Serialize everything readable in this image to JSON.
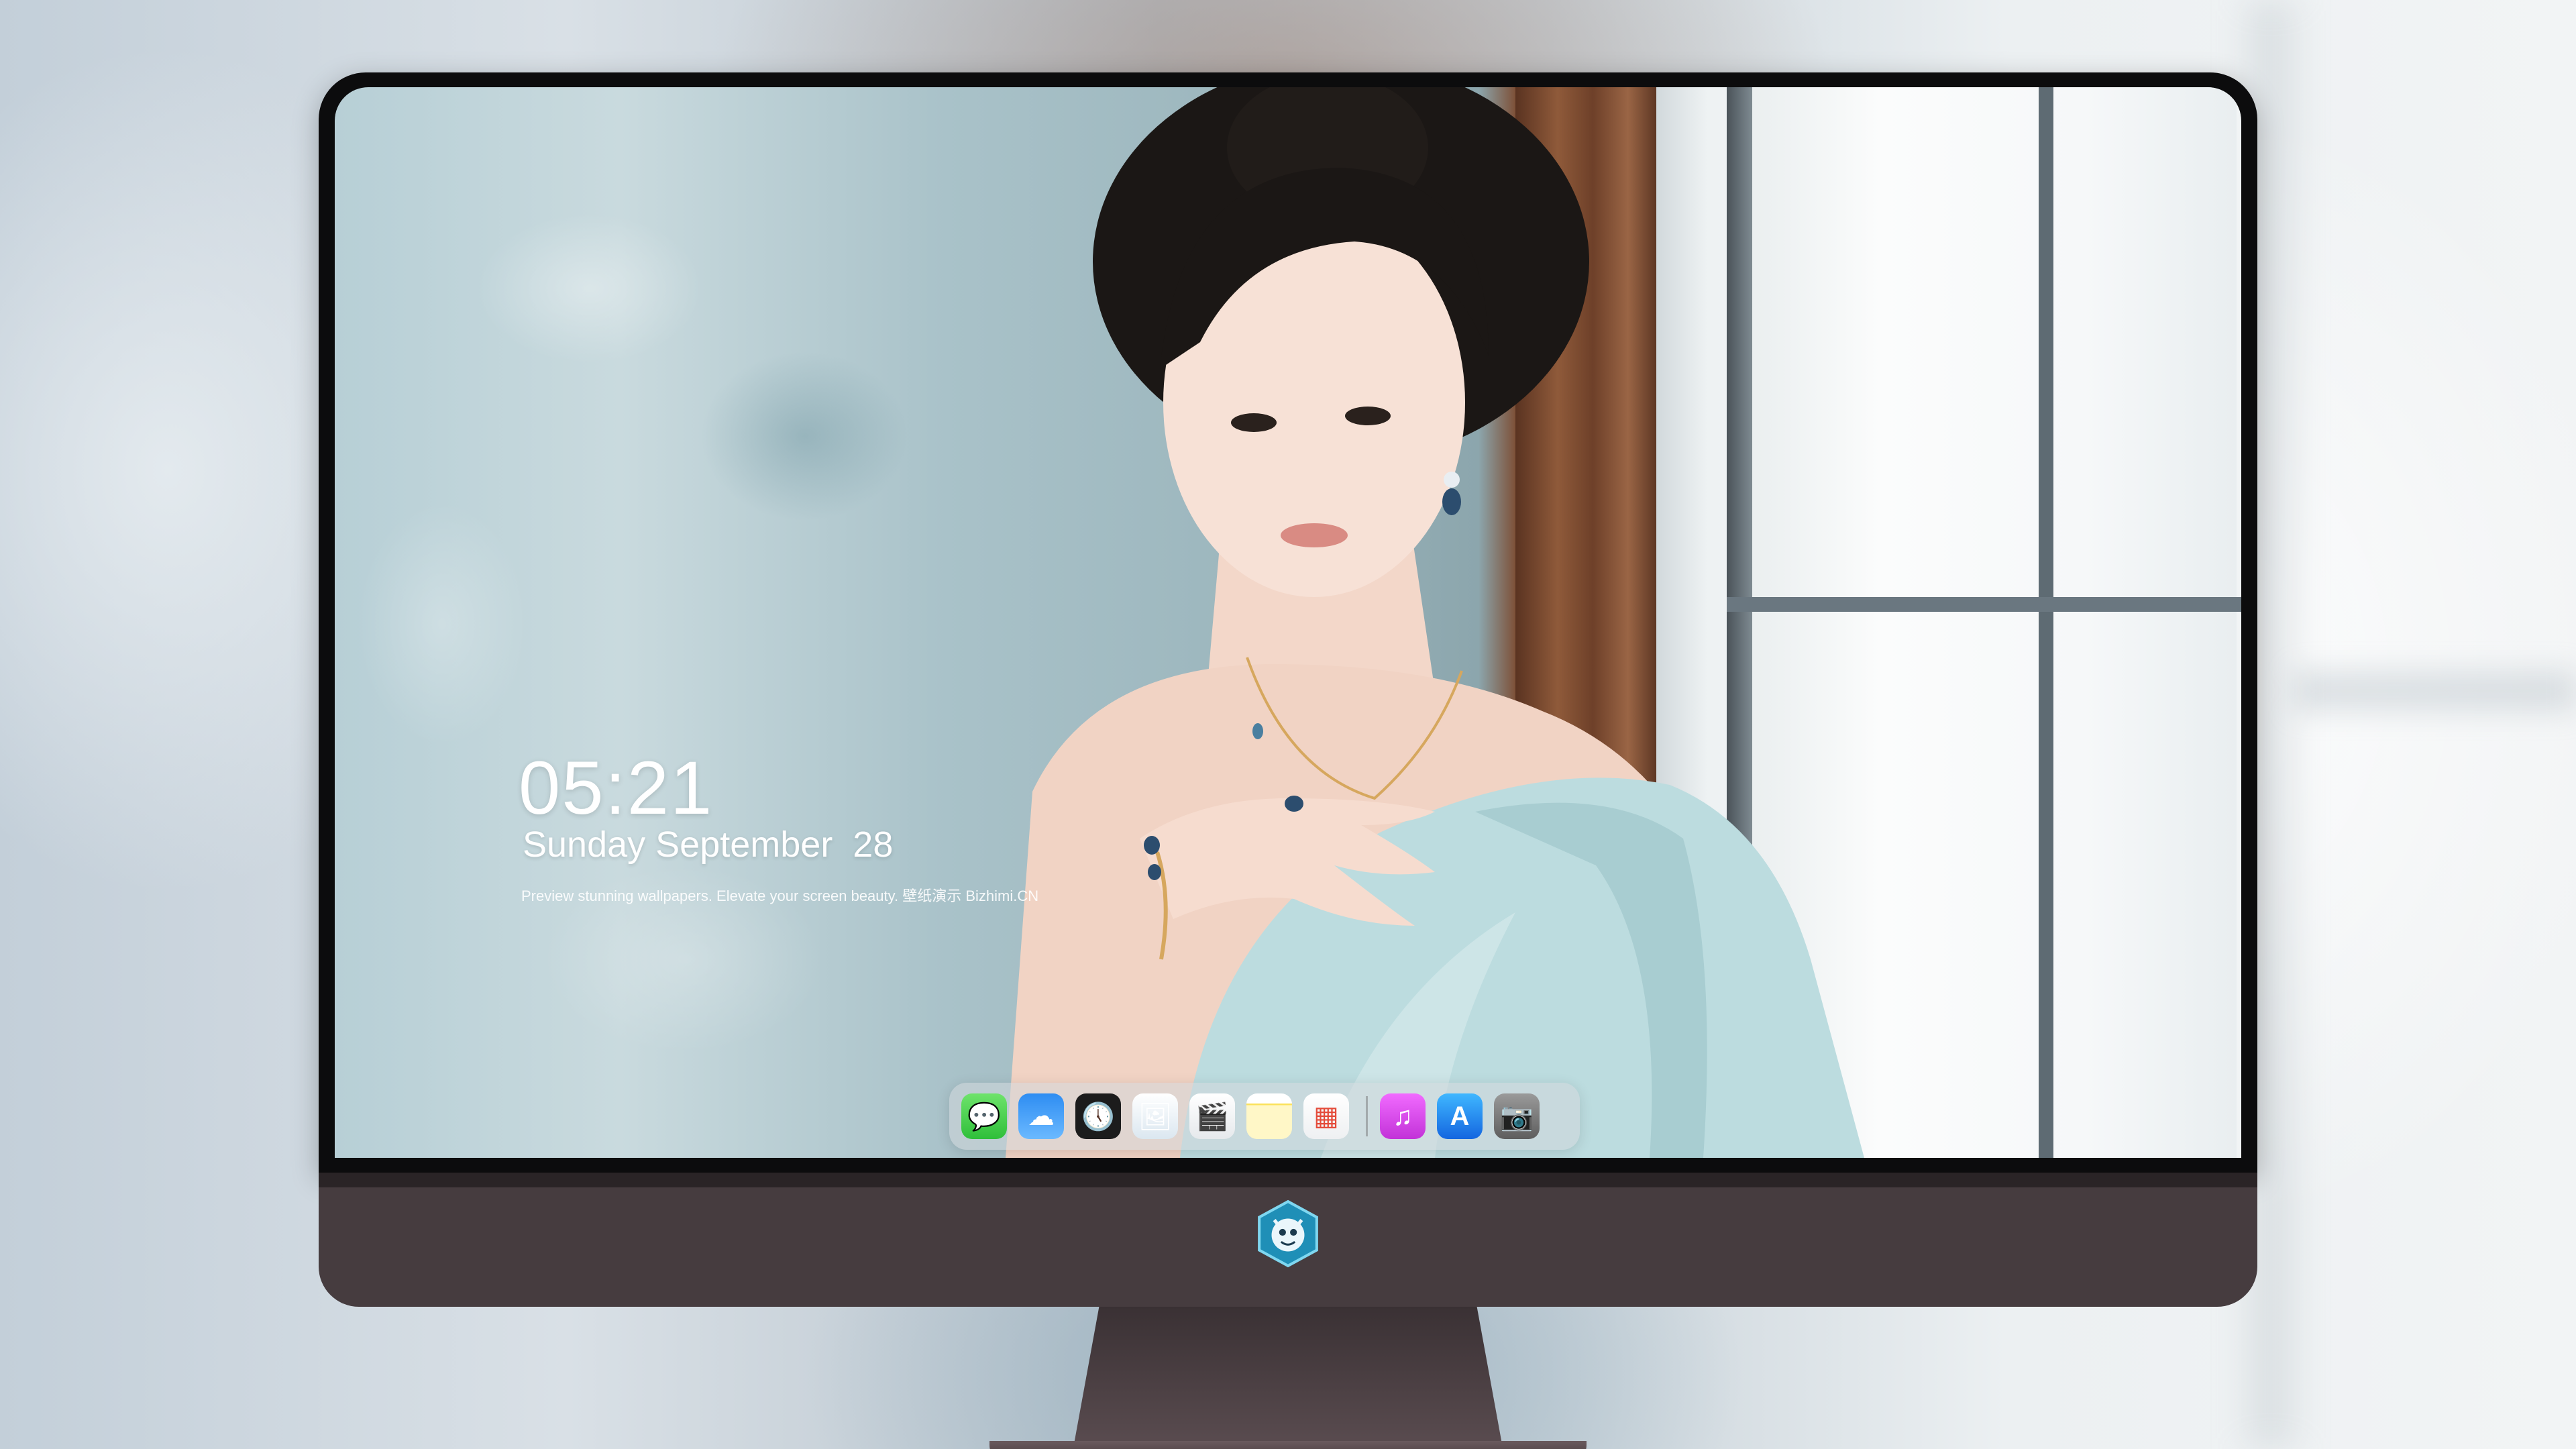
{
  "lockscreen": {
    "time": "05:21",
    "date": "Sunday September  28",
    "tagline": "Preview stunning wallpapers. Elevate your screen beauty. 壁纸演示 Bizhimi.CN"
  },
  "dock": {
    "apps": [
      {
        "name": "messages-icon",
        "glyph": "💬"
      },
      {
        "name": "weather-icon",
        "glyph": "☁"
      },
      {
        "name": "clock-icon",
        "glyph": "🕔"
      },
      {
        "name": "preview-icon",
        "glyph": "🖼"
      },
      {
        "name": "claquette-icon",
        "glyph": "🎬"
      },
      {
        "name": "notes-icon",
        "glyph": ""
      },
      {
        "name": "photobooth-icon",
        "glyph": "▦"
      },
      {
        "name": "music-icon",
        "glyph": "♫"
      },
      {
        "name": "appstore-icon",
        "glyph": "A"
      },
      {
        "name": "camera-icon",
        "glyph": "📷"
      }
    ]
  },
  "colors": {
    "bezel": "#0c0c0d",
    "chin": "#463c3f",
    "dress": "#bcdcdf"
  }
}
